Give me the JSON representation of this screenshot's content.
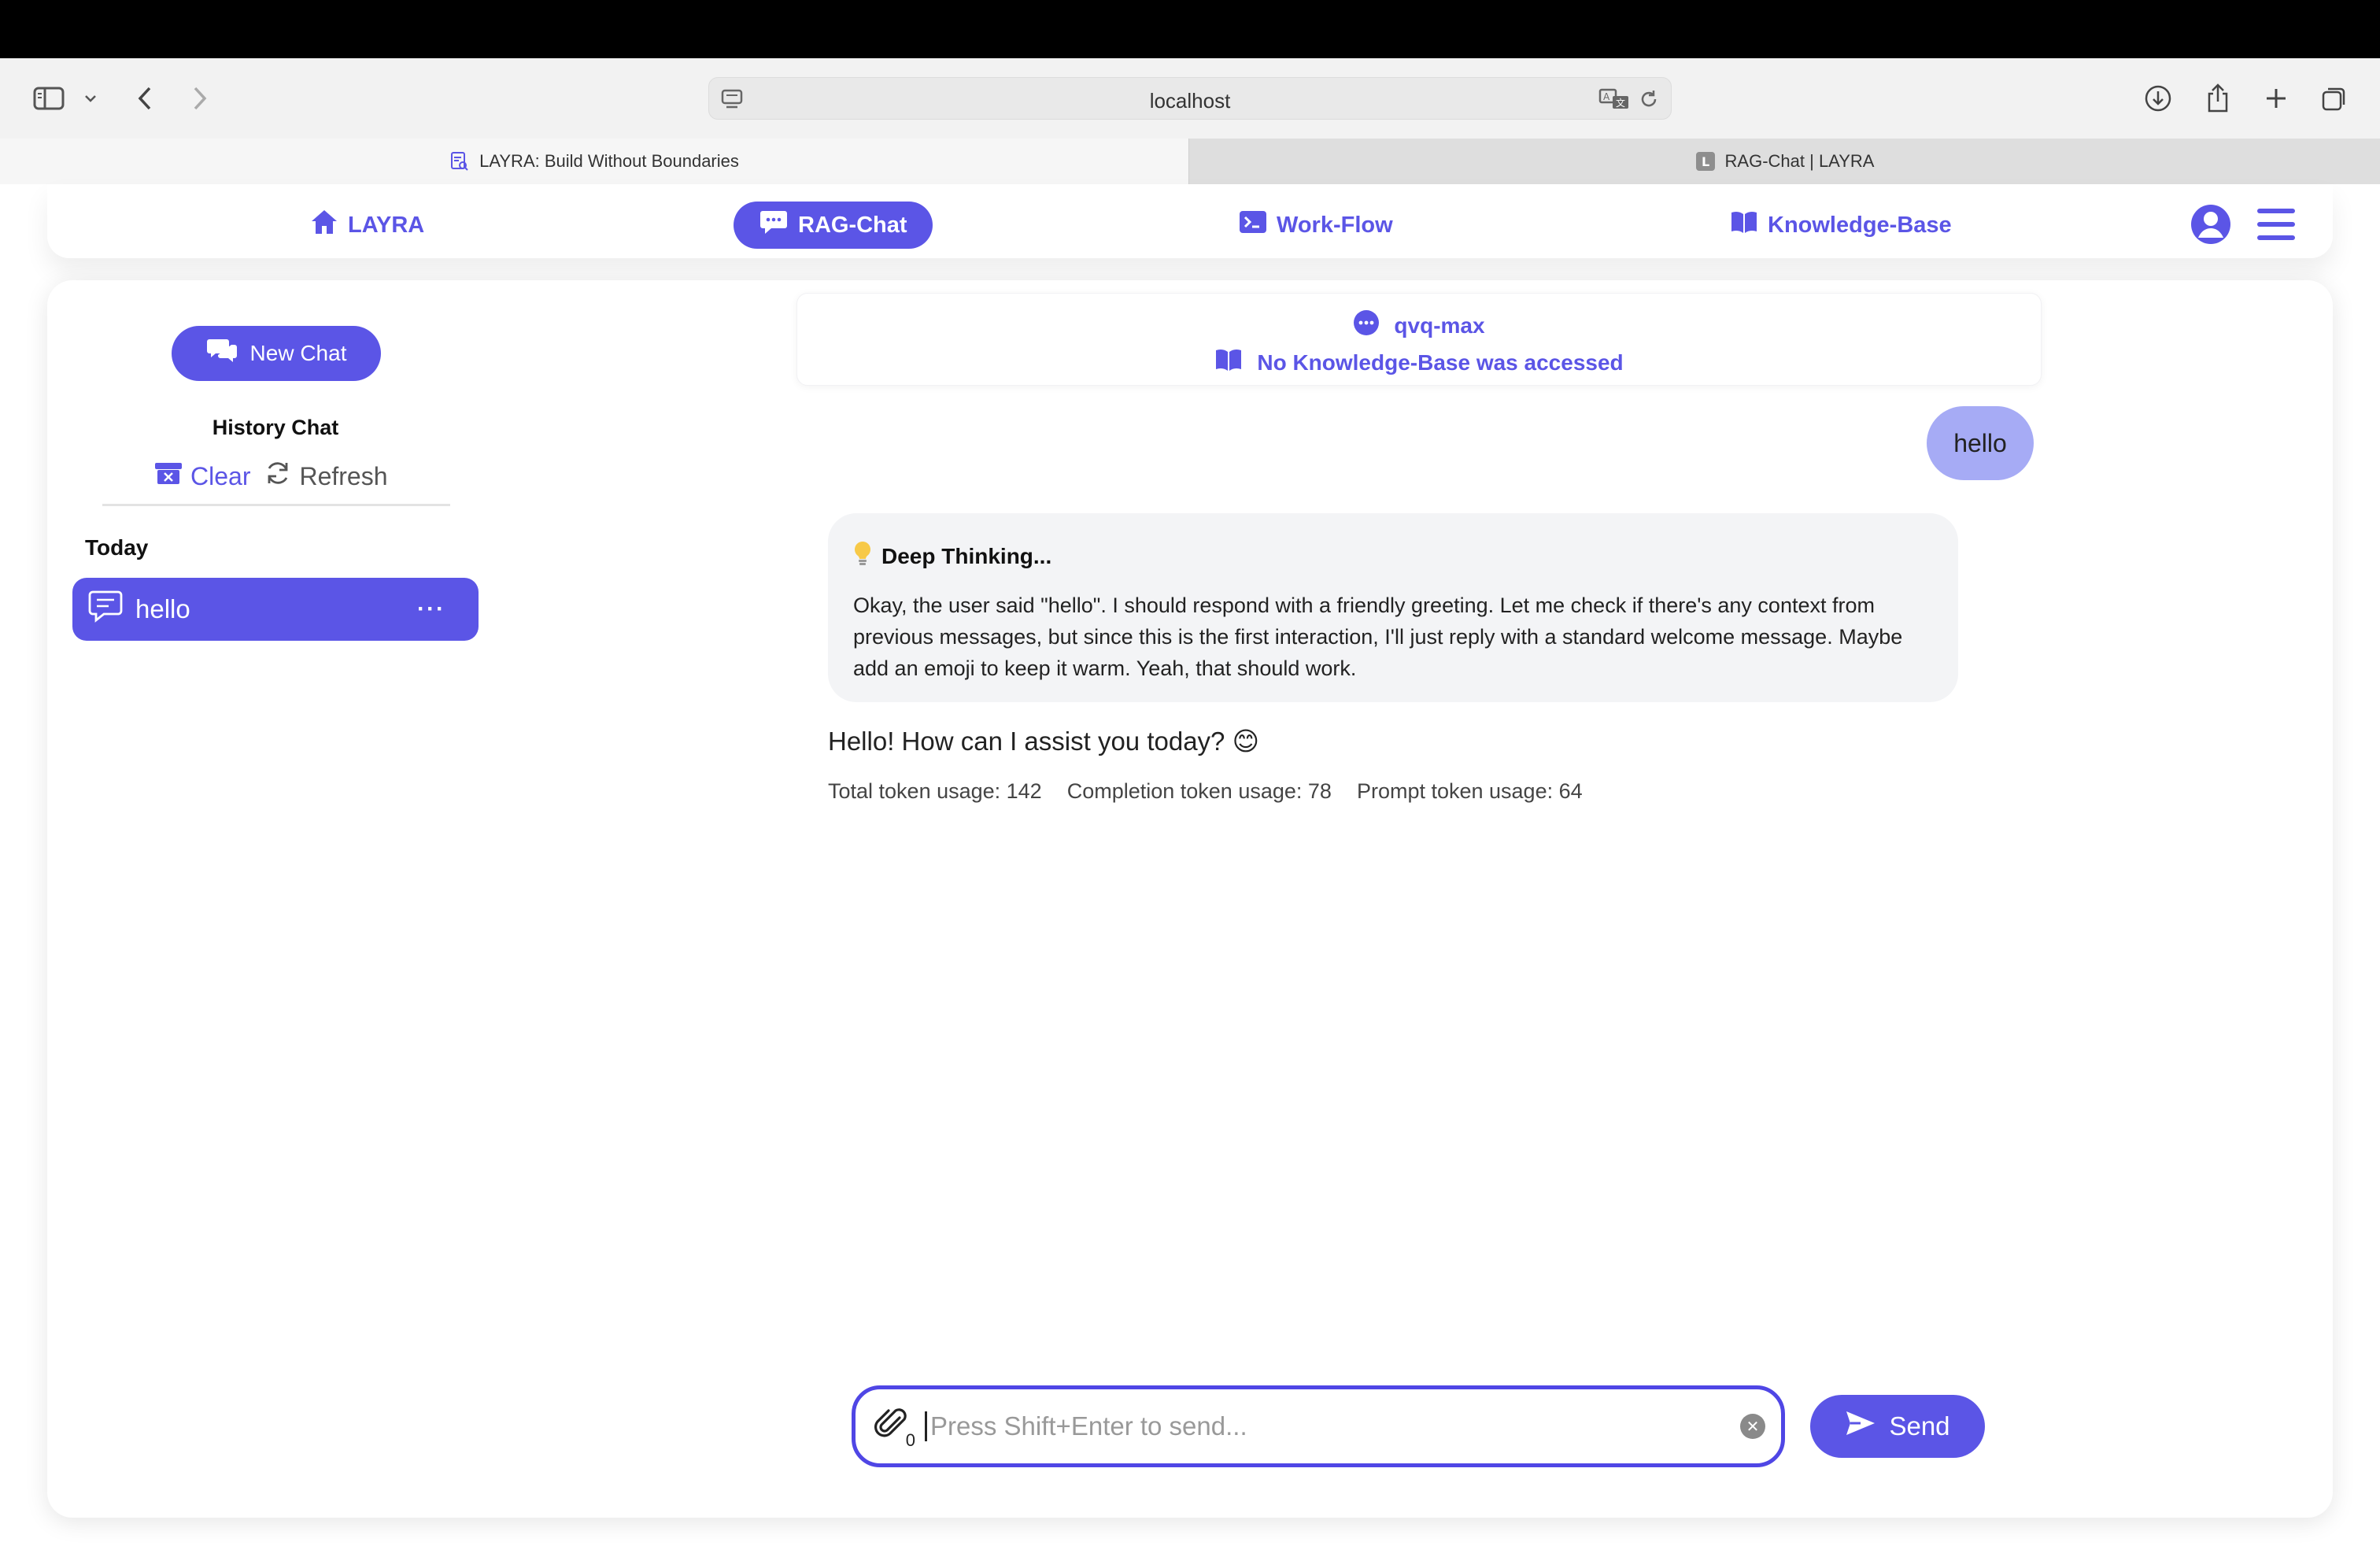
{
  "browser": {
    "url": "localhost",
    "tabs": [
      {
        "title": "LAYRA: Build Without Boundaries",
        "favicon": "document-search-icon"
      },
      {
        "title": "RAG-Chat | LAYRA",
        "favicon": "letter-l-icon"
      }
    ]
  },
  "nav": {
    "items": [
      {
        "label": "LAYRA",
        "icon": "home-icon"
      },
      {
        "label": "RAG-Chat",
        "icon": "chat-bubble-icon",
        "active": true
      },
      {
        "label": "Work-Flow",
        "icon": "terminal-icon"
      },
      {
        "label": "Knowledge-Base",
        "icon": "book-icon"
      }
    ]
  },
  "sidebar": {
    "new_chat_label": "New Chat",
    "history_title": "History Chat",
    "clear_label": "Clear",
    "refresh_label": "Refresh",
    "group_label": "Today",
    "chats": [
      {
        "label": "hello",
        "menu": "···"
      }
    ]
  },
  "chat": {
    "model_name": "qvq-max",
    "kb_status": "No Knowledge-Base was accessed",
    "user_message": "hello",
    "thinking_title": "Deep Thinking...",
    "thinking_text": "Okay, the user said \"hello\". I should respond with a friendly greeting. Let me check if there's any context from previous messages, but since this is the first interaction, I'll just reply with a standard welcome message. Maybe add an emoji to keep it warm. Yeah, that should work.",
    "answer": "Hello! How can I assist you today? 😊",
    "usage": {
      "total": "Total token usage: 142",
      "completion": "Completion token usage: 78",
      "prompt": "Prompt token usage: 64"
    }
  },
  "composer": {
    "placeholder": "Press Shift+Enter to send...",
    "attachment_count": "0",
    "send_label": "Send"
  },
  "colors": {
    "accent": "#5b55e6",
    "user_bubble": "#a6abf5",
    "thinking_bg": "#f3f4f6"
  }
}
